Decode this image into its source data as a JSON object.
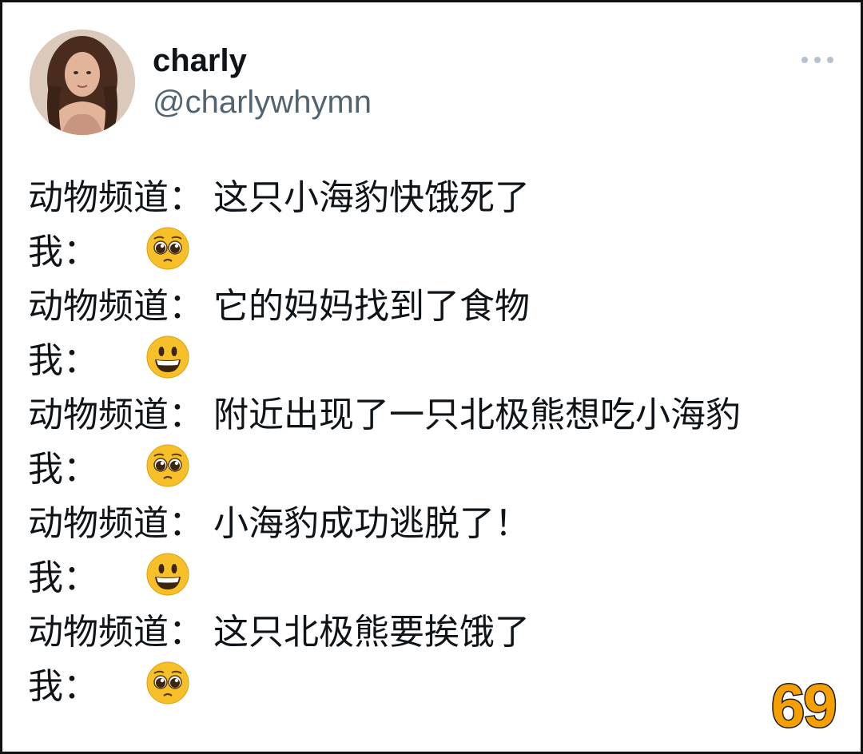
{
  "tweet": {
    "display_name": "charly",
    "handle": "@charlywhymn",
    "more_icon": "more-dots-icon",
    "lines": [
      {
        "speaker": "动物频道",
        "colon": "：",
        "text": "这只小海豹快饿死了",
        "emoji": null
      },
      {
        "speaker": "我",
        "colon": "：",
        "text": "",
        "emoji": "pleading-face-emoji"
      },
      {
        "speaker": "动物频道",
        "colon": "：",
        "text": "它的妈妈找到了食物",
        "emoji": null
      },
      {
        "speaker": "我",
        "colon": "：",
        "text": "",
        "emoji": "grinning-face-emoji"
      },
      {
        "speaker": "动物频道",
        "colon": "：",
        "text": "附近出现了一只北极熊想吃小海豹",
        "emoji": null
      },
      {
        "speaker": "我",
        "colon": "：",
        "text": "",
        "emoji": "pleading-face-emoji"
      },
      {
        "speaker": "动物频道",
        "colon": "：",
        "text": "小海豹成功逃脱了！",
        "emoji": null
      },
      {
        "speaker": "我",
        "colon": "：",
        "text": "",
        "emoji": "grinning-face-emoji"
      },
      {
        "speaker": "动物频道",
        "colon": "：",
        "text": "这只北极熊要挨饿了",
        "emoji": null
      },
      {
        "speaker": "我",
        "colon": "：",
        "text": "",
        "emoji": "pleading-face-emoji"
      }
    ]
  },
  "badge": {
    "value": "69",
    "color": "#f5a000"
  },
  "colors": {
    "text": "#0f1419",
    "handle": "#536471",
    "emoji_yellow": "#f7c028"
  }
}
